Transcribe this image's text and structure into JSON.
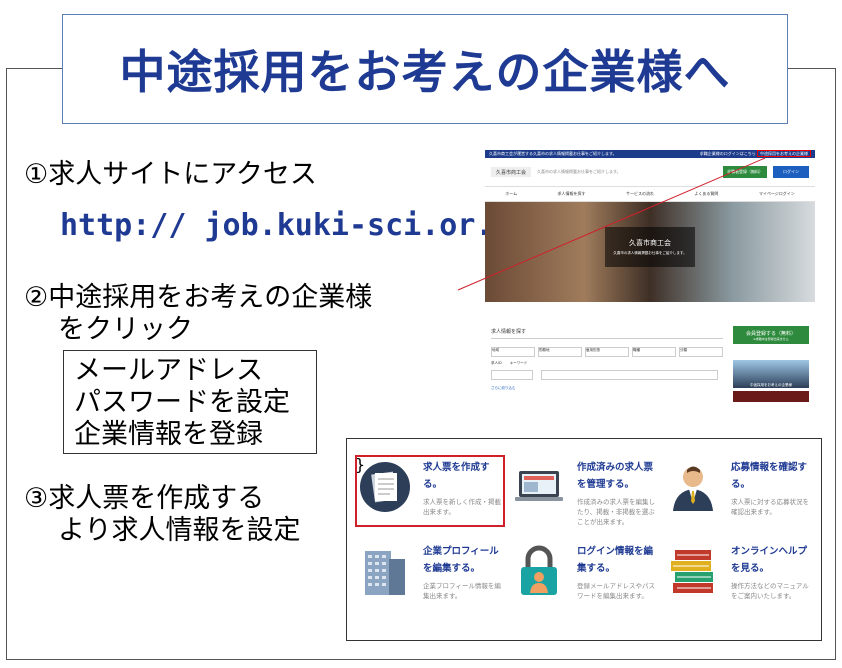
{
  "title": "中途採用をお考えの企業様へ",
  "steps": {
    "step1": "①求人サイトにアクセス",
    "url": "http://  job.kuki-sci.or.jp",
    "step2_line1": "②中途採用をお考えの企業様",
    "step2_line2": "をクリック",
    "box_lines": [
      "メールアドレス",
      "パスワードを設定",
      "企業情報を登録"
    ],
    "step3_line1": "③求人票を作成する",
    "step3_line2": "より求人情報を設定"
  },
  "site": {
    "topbar_left": "久喜市商工会が運営する久喜市の求人情報掲載お仕事をご紹介します。",
    "topbar_right1": "求職企業様のログインはこちら",
    "topbar_right2": "中途採用をお考えの企業様",
    "logo": "久喜市商工会",
    "header_text": "久喜市の求人情報掲載お仕事をご紹介します。",
    "register_button": "求職者登録（無料）",
    "login_button": "ログイン",
    "nav": [
      "ホーム",
      "求人情報を探す",
      "サービスの流れ",
      "よくある質問",
      "マイページログイン"
    ],
    "hero_logo": "久喜市商工会",
    "hero_sub": "久喜市の求人情報掲載お仕事をご紹介します。",
    "search_title": "求人情報を探す",
    "selects": [
      "地域",
      "勤務地",
      "雇用形態",
      "職種",
      "分類"
    ],
    "keyword_labels": [
      "求人ID",
      "キーワード"
    ],
    "more_link": "さらに絞り込む",
    "member_register": "会員登録する（無料）",
    "member_register_sub": "※求職中は登録出来ません",
    "banner_text": "中途採用をお考えの企業様"
  },
  "features": [
    {
      "title": "求人票を作成する。",
      "desc": "求人票を新しく作成・掲載出来ます。",
      "icon": "document-stack-icon"
    },
    {
      "title": "作成済みの求人票を管理する。",
      "desc": "作成済みの求人票を編集したり、掲載・非掲載を選ぶことが出来ます。",
      "icon": "laptop-icon"
    },
    {
      "title": "応募情報を確認する。",
      "desc": "求人票に対する応募状況を確認出来ます。",
      "icon": "businessman-icon"
    },
    {
      "title": "企業プロフィールを編集する。",
      "desc": "企業プロフィール情報を編集出来ます。",
      "icon": "office-building-icon"
    },
    {
      "title": "ログイン情報を編集する。",
      "desc": "登録メールアドレスやパスワードを編集出来ます。",
      "icon": "padlock-user-icon"
    },
    {
      "title": "オンラインヘルプを見る。",
      "desc": "操作方法などのマニュアルをご案内いたします。",
      "icon": "books-icon"
    }
  ],
  "colors": {
    "title_blue": "#1f3a93",
    "accent_red": "#d0202a",
    "site_navy": "#1d3b8b",
    "green": "#2e8b3d"
  }
}
